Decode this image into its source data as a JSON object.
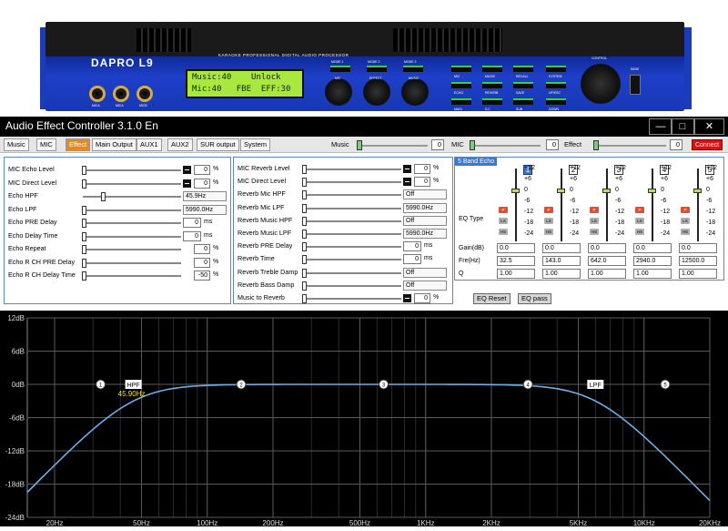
{
  "device": {
    "brand": "DAPRO L9",
    "model_text": "KARAOKE PROFESSIONAL DIGITAL AUDIO PROCESSOR",
    "lcd_line1": "Music:40    Unlock",
    "lcd_line2": "Mic:40   FBE  EFF:30",
    "jack_labels": [
      "MICA",
      "MICA",
      "MICB"
    ],
    "mode_labels": [
      "MODE 1",
      "MODE 2",
      "MODE 3"
    ],
    "knob_labels": [
      "MIC",
      "EFFECT",
      "MUSIC"
    ],
    "btn_labels": [
      "MIC",
      "MUSIC",
      "RECALL",
      "SYSTEM",
      "ECHO",
      "REVERB",
      "SAVE",
      "UP/ESC",
      "MAIN",
      "S.C",
      "SUB",
      "DOWN"
    ],
    "control_label": "CONTROL",
    "usb_label": "INDIE"
  },
  "window": {
    "title": "Audio Effect Controller 3.1.0 En",
    "min": "—",
    "max": "□",
    "close": "✕"
  },
  "tabs": [
    "Music",
    "MIC",
    "Effect",
    "Main Output",
    "AUX1",
    "AUX2",
    "SUR output",
    "System"
  ],
  "active_tab": "Effect",
  "volumes": [
    {
      "label": "Music",
      "value": "0"
    },
    {
      "label": "MIC",
      "value": "0"
    },
    {
      "label": "Effect",
      "value": "0"
    }
  ],
  "connect_label": "Connect",
  "echo": {
    "rows": [
      {
        "label": "MIC Echo Level",
        "value": "0",
        "unit": "%"
      },
      {
        "label": "MIC Direct Level",
        "value": "0",
        "unit": "%"
      },
      {
        "label": "Echo HPF",
        "value": "45.9Hz",
        "unit": ""
      },
      {
        "label": "Echo LPF",
        "value": "5990.0Hz",
        "unit": ""
      },
      {
        "label": "Echo PRE Delay",
        "value": "0",
        "unit": "ms"
      },
      {
        "label": "Echo Delay Time",
        "value": "0",
        "unit": "ms"
      },
      {
        "label": "Echo Repeat",
        "value": "0",
        "unit": "%"
      },
      {
        "label": "Echo R CH PRE Delay",
        "value": "0",
        "unit": "%"
      },
      {
        "label": "Echo R CH Delay Time",
        "value": "-50",
        "unit": "%"
      }
    ]
  },
  "reverb": {
    "rows": [
      {
        "label": "MIC Reverb Level",
        "value": "0",
        "unit": "%"
      },
      {
        "label": "MIC Direct Level",
        "value": "0",
        "unit": "%"
      },
      {
        "label": "Reverb Mic HPF",
        "value": "Off",
        "unit": ""
      },
      {
        "label": "Reverb Mic LPF",
        "value": "5990.0Hz",
        "unit": ""
      },
      {
        "label": "Reverb Music HPF",
        "value": "Off",
        "unit": ""
      },
      {
        "label": "Reverb Music LPF",
        "value": "5990.0Hz",
        "unit": ""
      },
      {
        "label": "Reverb PRE Delay",
        "value": "0",
        "unit": "ms"
      },
      {
        "label": "Reverb Time",
        "value": "0",
        "unit": "ms"
      },
      {
        "label": "Reverb Treble Damp",
        "value": "Off",
        "unit": ""
      },
      {
        "label": "Reverb Bass Damp",
        "value": "Off",
        "unit": ""
      },
      {
        "label": "Music to Reverb",
        "value": "0",
        "unit": "%"
      }
    ]
  },
  "eq": {
    "title": "5 Band Echo",
    "scale": "+12\n+6\n0\n-6\n-12\n-18\n-24",
    "type_label": "EQ Type",
    "gain_label": "Gain(dB)",
    "freq_label": "Fre(Hz)",
    "q_label": "Q",
    "type_codes": [
      "P",
      "LS",
      "HS"
    ],
    "bands": [
      {
        "num": "1",
        "gain": "0.0",
        "freq": "32.5",
        "q": "1.00"
      },
      {
        "num": "2",
        "gain": "0.0",
        "freq": "143.0",
        "q": "1.00"
      },
      {
        "num": "3",
        "gain": "0.0",
        "freq": "642.0",
        "q": "1.00"
      },
      {
        "num": "4",
        "gain": "0.0",
        "freq": "2940.0",
        "q": "1.00"
      },
      {
        "num": "5",
        "gain": "0.0",
        "freq": "12500.0",
        "q": "1.00"
      }
    ],
    "reset_label": "EQ Reset",
    "pass_label": "EQ pass"
  },
  "chart_data": {
    "type": "line",
    "xscale": "log",
    "xlim": [
      15,
      20000
    ],
    "ylim": [
      -24,
      12
    ],
    "ytick_labels": [
      "12dB",
      "6dB",
      "0dB",
      "-6dB",
      "-12dB",
      "-18dB",
      "-24dB"
    ],
    "yticks": [
      12,
      6,
      0,
      -6,
      -12,
      -18,
      -24
    ],
    "xtick_labels": [
      "20Hz",
      "50Hz",
      "100Hz",
      "200Hz",
      "500Hz",
      "1KHz",
      "2KHz",
      "5KHz",
      "10KHz",
      "20KHz"
    ],
    "xticks": [
      20,
      50,
      100,
      200,
      500,
      1000,
      2000,
      5000,
      10000,
      20000
    ],
    "grid": true,
    "line_color": "#6ab0e8",
    "hpf": 45.9,
    "lpf": 5990,
    "markers": [
      {
        "label": "1",
        "x": 32.5,
        "y": 0
      },
      {
        "label": "2",
        "x": 143,
        "y": 0
      },
      {
        "label": "3",
        "x": 642,
        "y": 0
      },
      {
        "label": "4",
        "x": 2940,
        "y": 0
      },
      {
        "label": "5",
        "x": 12500,
        "y": 0
      }
    ],
    "filter_tags": [
      {
        "label": "HPF",
        "x": 45.9
      },
      {
        "label": "LPF",
        "x": 5990
      }
    ],
    "hpf_readout": "45.90Hz"
  }
}
